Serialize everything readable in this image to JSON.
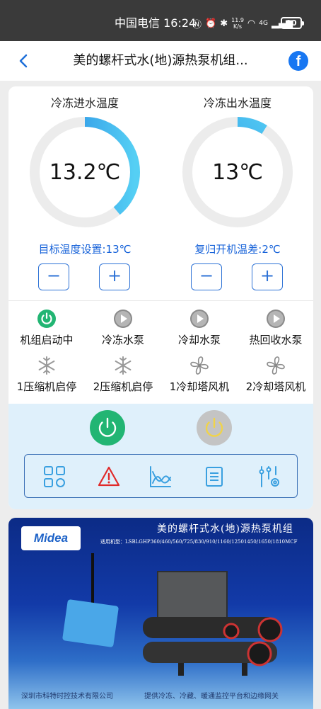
{
  "status_bar": {
    "carrier_time": "中国电信 16:24",
    "speed_top": "11.9",
    "speed_unit": "K/s",
    "network": "4G",
    "battery": "90"
  },
  "nav": {
    "title": "美的螺杆式水(地)源热泵机组..."
  },
  "gauges": [
    {
      "title": "冷冻进水温度",
      "value": "13.2℃",
      "fill_fraction": 0.39,
      "setting_label": "目标温度设置:13℃",
      "minus": "−",
      "plus": "+"
    },
    {
      "title": "冷冻出水温度",
      "value": "13℃",
      "fill_fraction": 0.09,
      "setting_label": "复归开机温差:2℃",
      "minus": "−",
      "plus": "+"
    }
  ],
  "status_items": [
    {
      "label": "机组启动中",
      "icon": "power-on-icon",
      "active": true
    },
    {
      "label": "冷冻水泵",
      "icon": "pump-play-icon",
      "active": false
    },
    {
      "label": "冷却水泵",
      "icon": "pump-play-icon",
      "active": false
    },
    {
      "label": "热回收水泵",
      "icon": "pump-play-icon",
      "active": false
    },
    {
      "label": "1压缩机启停",
      "icon": "snowflake-icon",
      "active": false
    },
    {
      "label": "2压缩机启停",
      "icon": "snowflake-icon",
      "active": false
    },
    {
      "label": "1冷却塔风机",
      "icon": "fan-icon",
      "active": false
    },
    {
      "label": "2冷却塔风机",
      "icon": "fan-icon",
      "active": false
    }
  ],
  "controls": {
    "power_on_color": "#22b573",
    "power_off_color": "#bdbdbd",
    "tools": [
      "grid-icon",
      "alarm-icon",
      "chart-icon",
      "list-icon",
      "settings-sliders-icon"
    ]
  },
  "banner": {
    "logo": "Midea",
    "headline": "美的螺杆式水(地)源热泵机组",
    "models": "适用机型：LSBLGHP360/460/560/725/830/910/1160/12501450/1650/1810MCF",
    "footer_left": "深圳市科特时控技术有限公司",
    "footer_right": "提供冷冻、冷藏、暖通监控平台和边缘网关"
  },
  "colors": {
    "accent_blue": "#2f73d6",
    "gauge_arc": "#3bb6ee",
    "gauge_track": "#e9e9e9"
  }
}
